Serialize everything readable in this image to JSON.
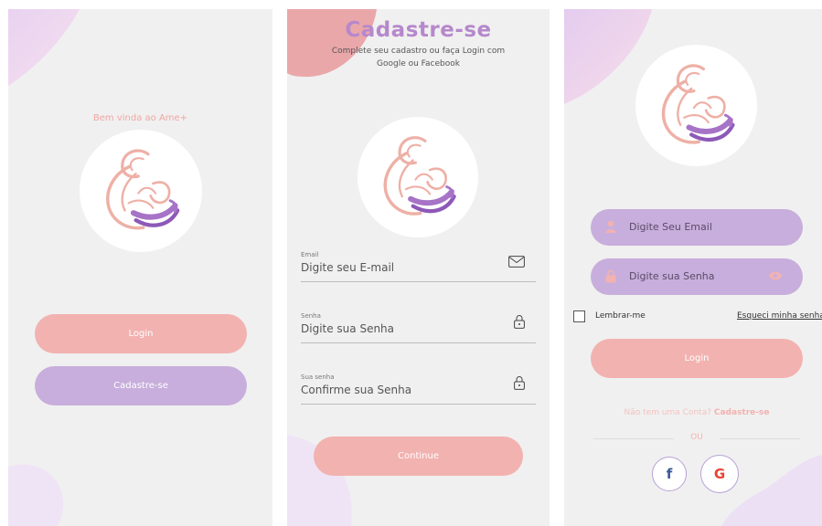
{
  "screen1": {
    "welcome": "Bem vinda ao Ame+",
    "login_label": "Login",
    "signup_label": "Cadastre-se"
  },
  "screen2": {
    "title": "Cadastre-se",
    "subtitle": "Complete seu cadastro ou faça Login com Google ou Facebook",
    "fields": [
      {
        "label": "Email",
        "placeholder": "Digite seu E-mail",
        "icon": "mail-icon"
      },
      {
        "label": "Senha",
        "placeholder": "Digite sua Senha",
        "icon": "lock-icon"
      },
      {
        "label": "Sua senha",
        "placeholder": "Confirme sua Senha",
        "icon": "lock-icon"
      }
    ],
    "continue_label": "Continue"
  },
  "screen3": {
    "email_placeholder": "Digite Seu Email",
    "password_placeholder": "Digite sua Senha",
    "remember_label": "Lembrar-me",
    "forgot_label": "Esqueci minha senha",
    "login_label": "Login",
    "no_account_text": "Não tem uma Conta?",
    "signup_link": "Cadastre-se",
    "or_label": "OU",
    "facebook_glyph": "f",
    "google_glyph": "G"
  },
  "colors": {
    "pink": "#f2b2b0",
    "lavender": "#c8aedc",
    "title_purple": "#b688cc",
    "background": "#f0f0f0"
  }
}
